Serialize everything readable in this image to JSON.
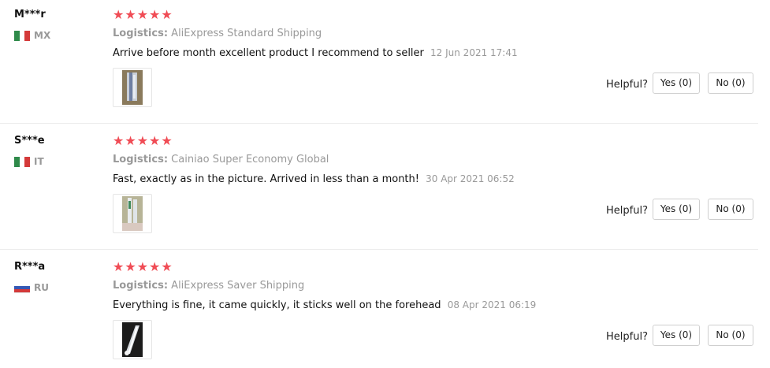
{
  "reviews": [
    {
      "user": "M***r",
      "country": "MX",
      "flag_colors": [
        "#2f8a4a",
        "#ffffff",
        "#d43a3a"
      ],
      "stars": "★★★★★",
      "logistics_label": "Logistics:",
      "logistics_value": "AliExpress Standard Shipping",
      "text": "Arrive before month excellent product I recommend to seller",
      "date": "12 Jun 2021 17:41",
      "helpful_label": "Helpful?",
      "yes_label": "Yes (0)",
      "no_label": "No (0)"
    },
    {
      "user": "S***e",
      "country": "IT",
      "flag_colors": [
        "#2f8a4a",
        "#ffffff",
        "#d43a3a"
      ],
      "stars": "★★★★★",
      "logistics_label": "Logistics:",
      "logistics_value": "Cainiao Super Economy Global",
      "text": "Fast, exactly as in the picture. Arrived in less than a month!",
      "date": "30 Apr 2021 06:52",
      "helpful_label": "Helpful?",
      "yes_label": "Yes (0)",
      "no_label": "No (0)"
    },
    {
      "user": "R***a",
      "country": "RU",
      "flag_colors": [
        "#ffffff",
        "#3559b5",
        "#d43a3a"
      ],
      "stars": "★★★★★",
      "logistics_label": "Logistics:",
      "logistics_value": "AliExpress Saver Shipping",
      "text": "Everything is fine, it came quickly, it sticks well on the forehead",
      "date": "08 Apr 2021 06:19",
      "helpful_label": "Helpful?",
      "yes_label": "Yes (0)",
      "no_label": "No (0)"
    }
  ],
  "colors": {
    "star": "#f04c55",
    "muted": "#999999",
    "divider": "#ececec",
    "button_border": "#cfcfcf"
  }
}
